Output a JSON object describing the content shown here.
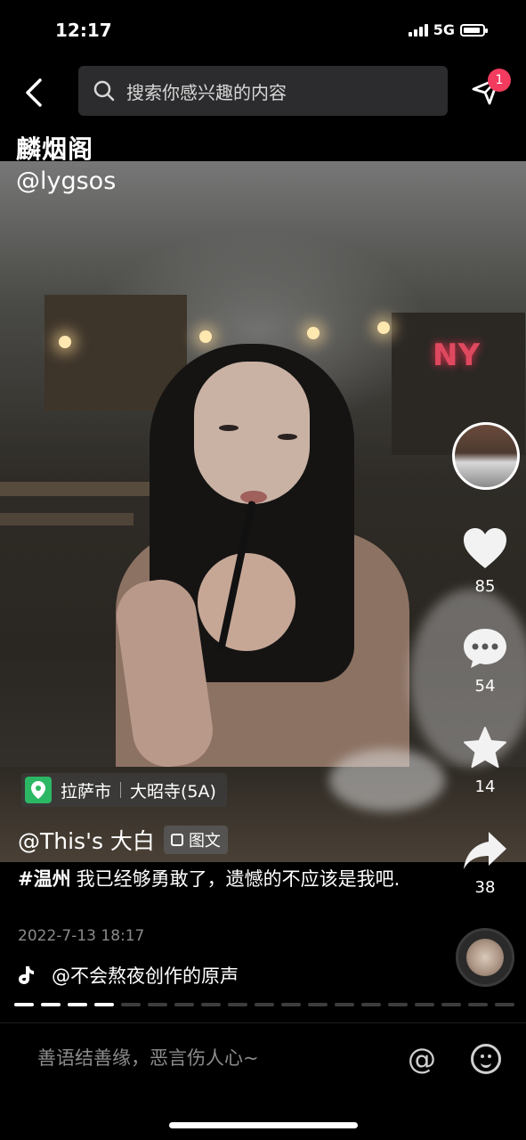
{
  "status_bar": {
    "time": "12:17",
    "network": "5G"
  },
  "header": {
    "search_placeholder": "搜索你感兴趣的内容",
    "notification_count": "1"
  },
  "watermark": {
    "line1": "麟烟阁",
    "line2": "@lygsos"
  },
  "location": {
    "city": "拉萨市",
    "place": "大昭寺(5A)"
  },
  "post": {
    "author": "@This's 大白",
    "type_tag": "图文",
    "hashtag": "#温州",
    "caption": "我已经够勇敢了，遗憾的不应该是我吧.",
    "date": "2022-7-13 18:17",
    "music": "@不会熬夜创作的原声"
  },
  "rail": {
    "likes": "85",
    "comments": "54",
    "favorites": "14",
    "shares": "38"
  },
  "photo_progress": {
    "current": 4,
    "total": 19
  },
  "comment_bar": {
    "placeholder": "善语结善缘，恶言伤人心~",
    "at_symbol": "@"
  },
  "colors": {
    "badge": "#f23b5f",
    "location_pin": "#2cb765",
    "background": "#000000"
  }
}
